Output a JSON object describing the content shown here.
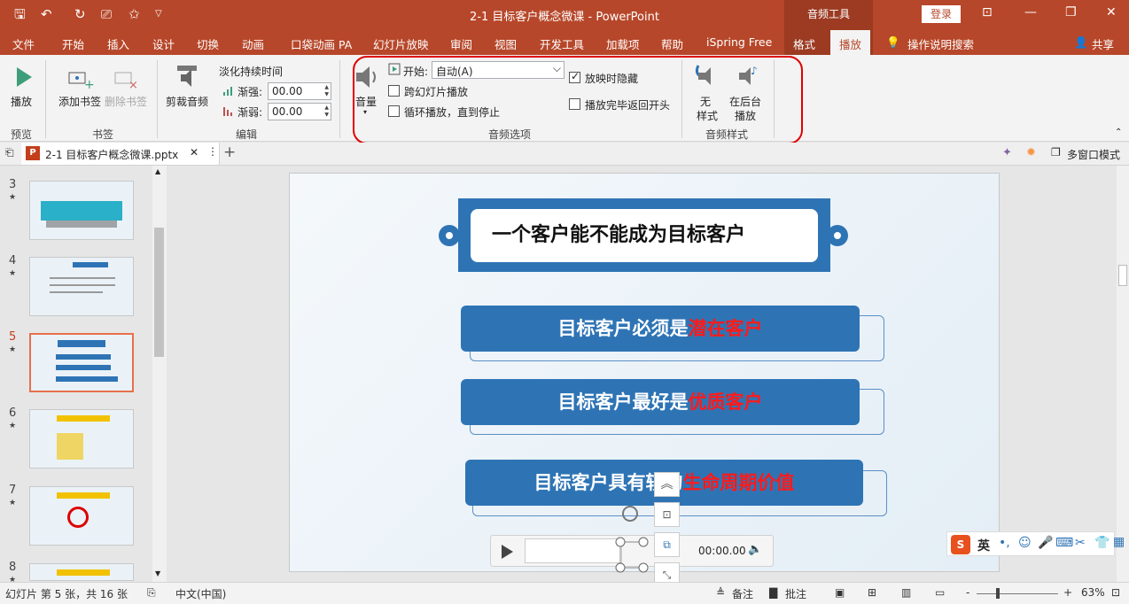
{
  "app": {
    "doc_title": "2-1 目标客户概念微课  -  PowerPoint",
    "context_group": "音频工具",
    "login": "登录"
  },
  "tabs": [
    "文件",
    "开始",
    "插入",
    "设计",
    "切换",
    "动画",
    "口袋动画 PA",
    "幻灯片放映",
    "审阅",
    "视图",
    "开发工具",
    "加载项",
    "帮助",
    "iSpring Free",
    "格式",
    "播放",
    "操作说明搜索",
    "共享"
  ],
  "ribbon": {
    "play": "播放",
    "preview_group": "预览",
    "add_bookmark": "添加书签",
    "remove_bookmark": "删除书签",
    "bookmark_group": "书签",
    "trim_audio": "剪裁音频",
    "fade_duration": "淡化持续时间",
    "fade_in_label": "渐强:",
    "fade_in_value": "00.00",
    "fade_out_label": "渐弱:",
    "fade_out_value": "00.00",
    "edit_group": "编辑",
    "volume": "音量",
    "start_label": "开始:",
    "start_value": "自动(A)",
    "play_across_slides": "跨幻灯片播放",
    "loop_until_stopped": "循环播放，直到停止",
    "hide_during_show": "放映时隐藏",
    "rewind_after_playing": "播放完毕返回开头",
    "audio_options_group": "音频选项",
    "no_style": "无\n样式",
    "no_style_l1": "无",
    "no_style_l2": "样式",
    "play_in_bg_l1": "在后台",
    "play_in_bg_l2": "播放",
    "audio_styles_group": "音频样式",
    "hide_during_show_checked": true,
    "play_across_slides_checked": false,
    "loop_checked": false,
    "rewind_checked": false
  },
  "doctab": {
    "filename": "2-1 目标客户概念微课.pptx",
    "multi_window": "多窗口模式"
  },
  "thumbnails": [
    {
      "num": "3",
      "star": "★"
    },
    {
      "num": "4",
      "star": "★"
    },
    {
      "num": "5",
      "star": "★"
    },
    {
      "num": "6",
      "star": "★"
    },
    {
      "num": "7",
      "star": "★"
    },
    {
      "num": "8",
      "star": "★"
    }
  ],
  "slide": {
    "title": "一个客户能不能成为目标客户",
    "bar1_a": "目标客户必须是",
    "bar1_b": "潜在客户",
    "bar2_a": "目标客户最好是",
    "bar2_b": "优质客户",
    "bar3_a": "目标客户具有较",
    "bar3_mid": "的",
    "bar3_b": "生命周期价值",
    "player_time": "00:00.00"
  },
  "ime": {
    "lang": "英"
  },
  "status": {
    "slide_info": "幻灯片 第 5 张，共 16 张",
    "language": "中文(中国)",
    "notes": "备注",
    "comments": "批注",
    "zoom": "63%",
    "minus": "-",
    "plus": "+"
  },
  "colors": {
    "accent": "#b7472a",
    "slide_blue": "#2e74b5",
    "highlight_red": "#ff1a1a"
  }
}
